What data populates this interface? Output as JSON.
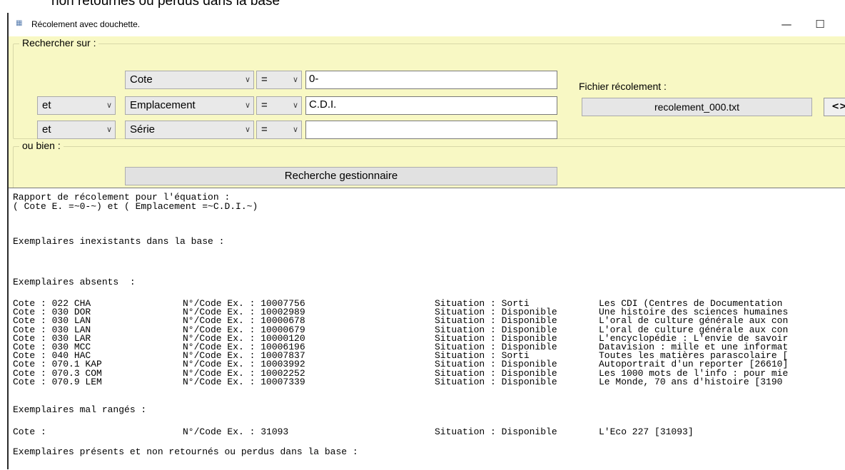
{
  "caption": "non retournés ou perdus dans la base",
  "window": {
    "title": "Récolement avec douchette.",
    "icon": "barcode-app-icon",
    "minimize": "—",
    "maximize": "☐",
    "close": "✕"
  },
  "search": {
    "legend": "Rechercher sur :",
    "rows": [
      {
        "connector": "",
        "field": "Cote",
        "operator": "=",
        "value": "0-"
      },
      {
        "connector": "et",
        "field": "Emplacement",
        "operator": "=",
        "value": "C.D.I."
      },
      {
        "connector": "et",
        "field": "Série",
        "operator": "=",
        "value": ""
      }
    ],
    "file_label": "Fichier récolement :",
    "file_name": "recolement_000.txt",
    "file_button": "<>"
  },
  "alt": {
    "legend": "ou bien :",
    "button": "Recherche gestionnaire"
  },
  "report": {
    "header1": "Rapport de récolement pour l'équation :",
    "header2": "( Cote E. =~0-~) et ( Emplacement =~C.D.I.~)",
    "inexistants": "Exemplaires inexistants dans la base :",
    "absents": "Exemplaires absents  :",
    "absent_rows": [
      {
        "cote": "Cote : 022 CHA",
        "code": "N°/Code Ex. : 10007756",
        "situation": "Situation : Sorti",
        "title": "Les CDI (Centres de Documentation"
      },
      {
        "cote": "Cote : 030 DOR",
        "code": "N°/Code Ex. : 10002989",
        "situation": "Situation : Disponible",
        "title": "Une histoire des sciences humaines"
      },
      {
        "cote": "Cote : 030 LAN",
        "code": "N°/Code Ex. : 10000678",
        "situation": "Situation : Disponible",
        "title": "L'oral de culture générale aux con"
      },
      {
        "cote": "Cote : 030 LAN",
        "code": "N°/Code Ex. : 10000679",
        "situation": "Situation : Disponible",
        "title": "L'oral de culture générale aux con"
      },
      {
        "cote": "Cote : 030 LAR",
        "code": "N°/Code Ex. : 10000120",
        "situation": "Situation : Disponible",
        "title": "L'encyclopédie : L'envie de savoir"
      },
      {
        "cote": "Cote : 030 MCC",
        "code": "N°/Code Ex. : 10006196",
        "situation": "Situation : Disponible",
        "title": "Datavision : mille et une informat"
      },
      {
        "cote": "Cote : 040 HAC",
        "code": "N°/Code Ex. : 10007837",
        "situation": "Situation : Sorti",
        "title": "Toutes les matières parascolaire ["
      },
      {
        "cote": "Cote : 070.1 KAP",
        "code": "N°/Code Ex. : 10003992",
        "situation": "Situation : Disponible",
        "title": "Autoportrait d'un reporter [26610]"
      },
      {
        "cote": "Cote : 070.3 COM",
        "code": "N°/Code Ex. : 10002252",
        "situation": "Situation : Disponible",
        "title": "Les 1000 mots de l'info : pour mie"
      },
      {
        "cote": "Cote : 070.9 LEM",
        "code": "N°/Code Ex. : 10007339",
        "situation": "Situation : Disponible",
        "title": "Le Monde, 70 ans d'histoire [3190"
      }
    ],
    "mal_ranges": "Exemplaires mal rangés :",
    "mal_rows": [
      {
        "cote": "Cote :",
        "code": "N°/Code Ex. : 31093",
        "situation": "Situation : Disponible",
        "title": "L'Eco 227 [31093]"
      }
    ],
    "presents": "Exemplaires présents et non retournés ou perdus dans la base :"
  }
}
